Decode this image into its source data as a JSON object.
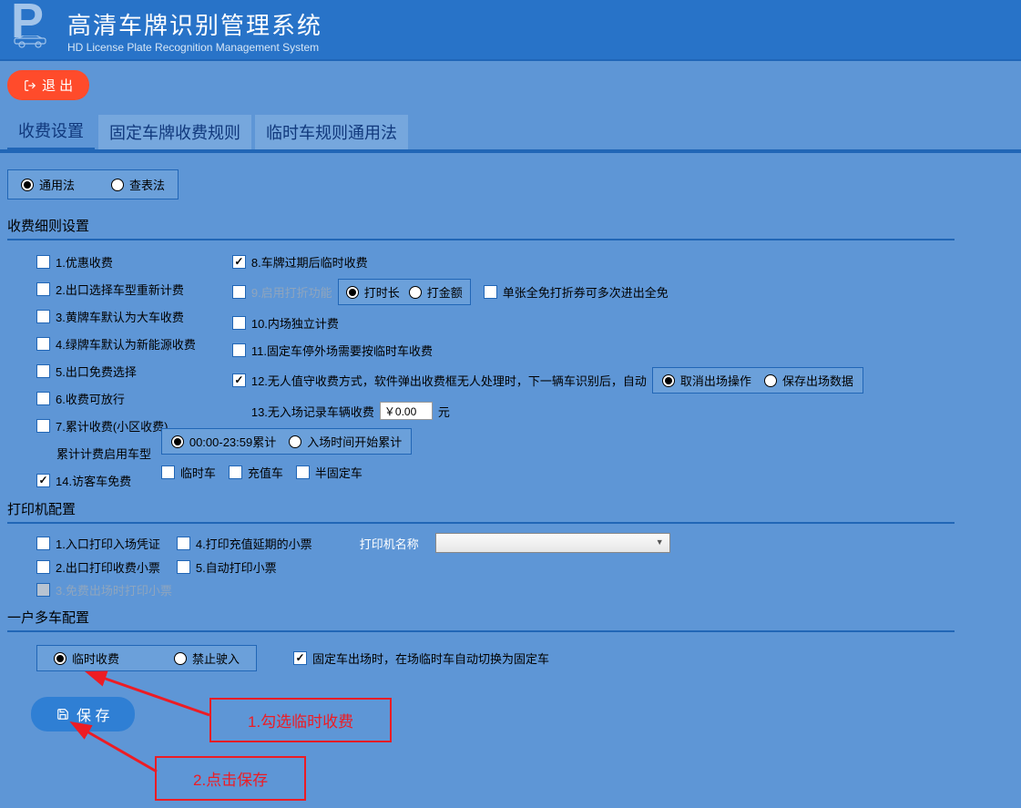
{
  "header": {
    "logo": "P",
    "title": "高清车牌识别管理系统",
    "subtitle": "HD License Plate Recognition Management System"
  },
  "toolbar": {
    "exit": "退 出"
  },
  "tabs": [
    "收费设置",
    "固定车牌收费规则",
    "临时车规则通用法"
  ],
  "top_radio": {
    "opt1": "通用法",
    "opt2": "查表法"
  },
  "sec1_title": "收费细则设置",
  "left_rules": {
    "r1": "1.优惠收费",
    "r2": "2.出口选择车型重新计费",
    "r3": "3.黄牌车默认为大车收费",
    "r4": "4.绿牌车默认为新能源收费",
    "r5": "5.出口免费选择",
    "r6": "6.收费可放行",
    "r7": "7.累计收费(小区收费)",
    "r7_sub_label": "累计计费启用车型",
    "r7_sub1": "临时车",
    "r7_sub2": "充值车",
    "r7_sub3": "半固定车",
    "r14": "14.访客车免费"
  },
  "right_rules": {
    "r8": "8.车牌过期后临时收费",
    "r9": "9.启用打折功能",
    "r9_opt1": "打时长",
    "r9_opt2": "打金额",
    "r9_side": "单张全免打折券可多次进出全免",
    "r10": "10.内场独立计费",
    "r11": "11.固定车停外场需要按临时车收费",
    "r12": "12.无人值守收费方式，软件弹出收费框无人处理时，下一辆车识别后，自动",
    "r12_opt1": "取消出场操作",
    "r12_opt2": "保存出场数据",
    "r13": "13.无入场记录车辆收费",
    "r13_value": "￥0.00",
    "r13_unit": "元",
    "r7box_opt1": "00:00-23:59累计",
    "r7box_opt2": "入场时间开始累计"
  },
  "sec2_title": "打印机配置",
  "printer": {
    "p1": "1.入口打印入场凭证",
    "p2": "2.出口打印收费小票",
    "p3": "3.免费出场时打印小票",
    "p4": "4.打印充值延期的小票",
    "p5": "5.自动打印小票",
    "name_label": "打印机名称"
  },
  "sec3_title": "一户多车配置",
  "multi": {
    "opt1": "临时收费",
    "opt2": "禁止驶入",
    "chk": "固定车出场时，在场临时车自动切换为固定车"
  },
  "save": "保  存",
  "anno1": "1.勾选临时收费",
  "anno2": "2.点击保存"
}
